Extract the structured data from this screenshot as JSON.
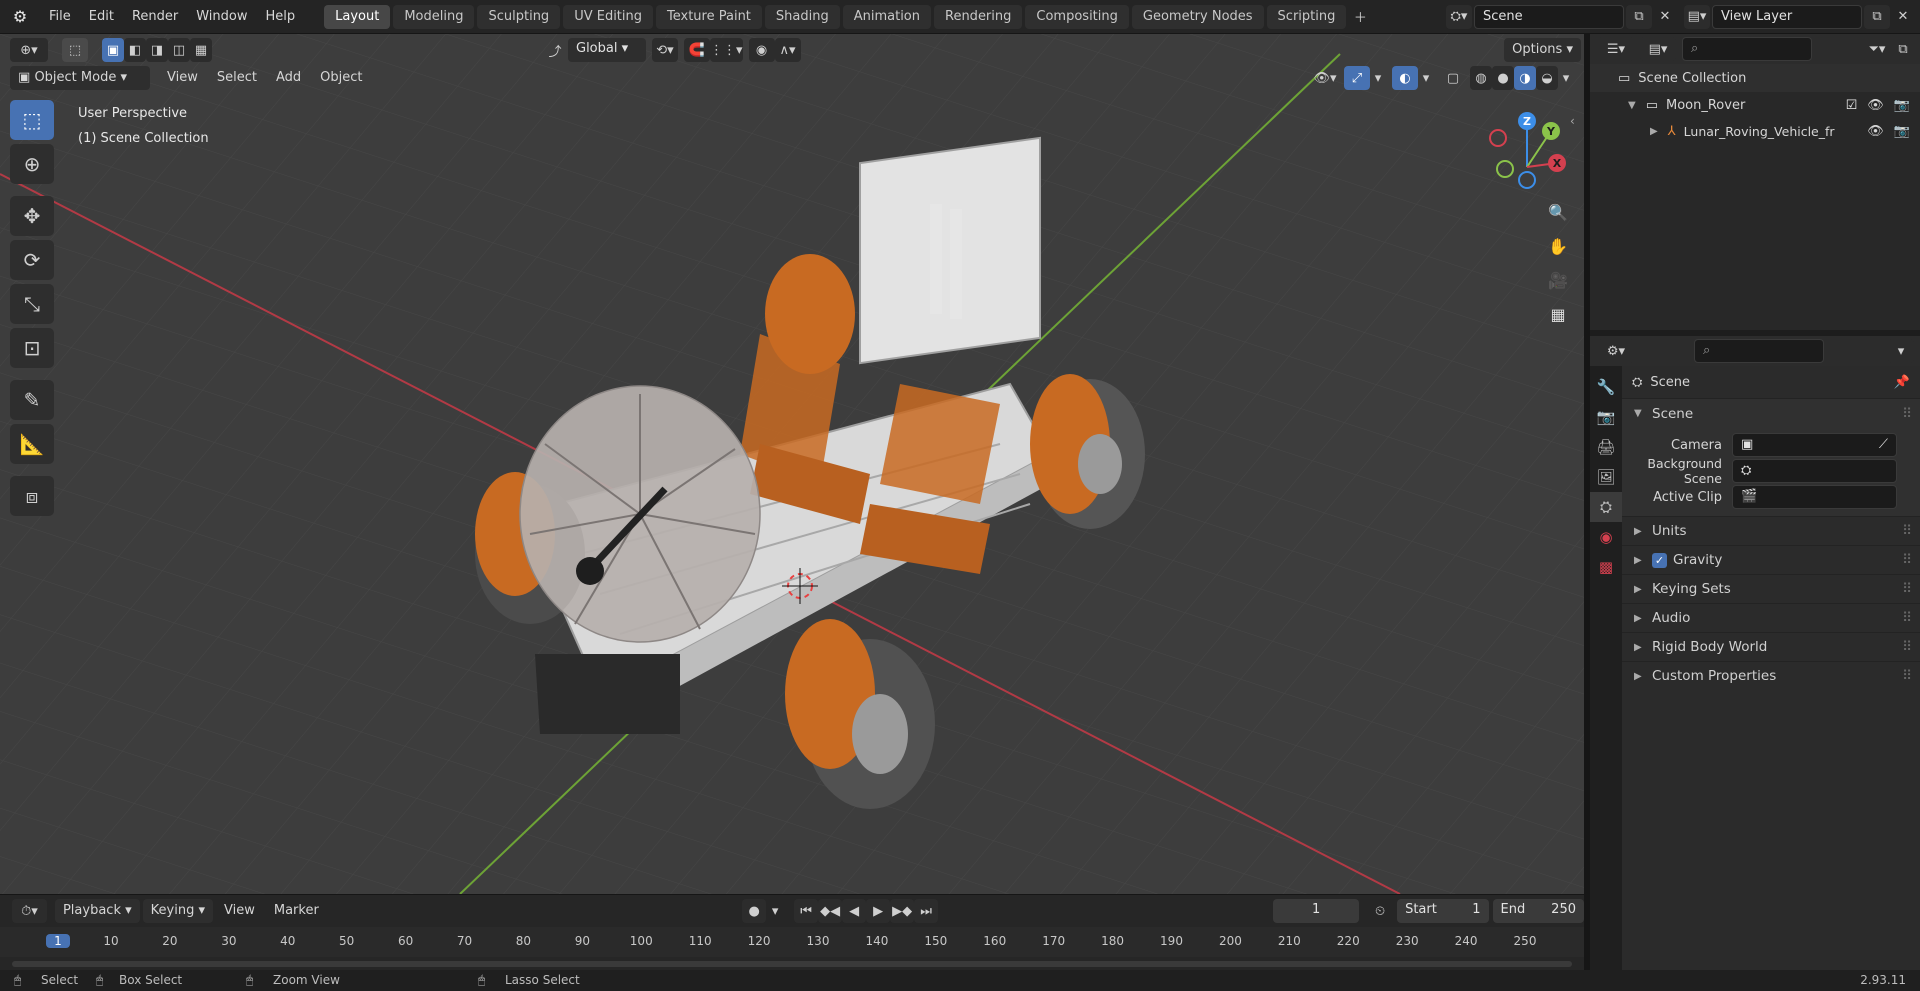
{
  "topbar": {
    "menus": [
      "File",
      "Edit",
      "Render",
      "Window",
      "Help"
    ],
    "workspaces": [
      "Layout",
      "Modeling",
      "Sculpting",
      "UV Editing",
      "Texture Paint",
      "Shading",
      "Animation",
      "Rendering",
      "Compositing",
      "Geometry Nodes",
      "Scripting"
    ],
    "active_workspace": "Layout",
    "scene_name": "Scene",
    "view_layer": "View Layer"
  },
  "viewport": {
    "orientation": "Global",
    "options_label": "Options",
    "mode": "Object Mode",
    "menus": [
      "View",
      "Select",
      "Add",
      "Object"
    ],
    "perspective_label": "User Perspective",
    "collection_label": "(1) Scene Collection",
    "gizmo_axes": [
      "X",
      "Y",
      "Z"
    ]
  },
  "outliner": {
    "root": "Scene Collection",
    "items": [
      {
        "label": "Moon_Rover",
        "level": 1
      },
      {
        "label": "Lunar_Roving_Vehicle_fr",
        "level": 2
      }
    ]
  },
  "properties": {
    "context": "Scene",
    "panel_title": "Scene",
    "fields": [
      {
        "label": "Camera",
        "value": ""
      },
      {
        "label": "Background Scene",
        "value": ""
      },
      {
        "label": "Active Clip",
        "value": ""
      }
    ],
    "subpanels": [
      "Units",
      "Gravity",
      "Keying Sets",
      "Audio",
      "Rigid Body World",
      "Custom Properties"
    ]
  },
  "timeline": {
    "menus": [
      "Playback",
      "Keying",
      "View",
      "Marker"
    ],
    "current_frame": "1",
    "start_label": "Start",
    "start_value": "1",
    "end_label": "End",
    "end_value": "250",
    "ruler": [
      "1",
      "10",
      "20",
      "30",
      "40",
      "50",
      "60",
      "70",
      "80",
      "90",
      "100",
      "110",
      "120",
      "130",
      "140",
      "150",
      "160",
      "170",
      "180",
      "190",
      "200",
      "210",
      "220",
      "230",
      "240",
      "250"
    ]
  },
  "statusbar": {
    "select": "Select",
    "box_select": "Box Select",
    "zoom_view": "Zoom View",
    "lasso_select": "Lasso Select",
    "version": "2.93.11"
  },
  "colors": {
    "accent": "#4772b3",
    "x_axis": "#d4404f",
    "y_axis": "#8bc34a",
    "z_axis": "#3c8ee8",
    "rover_orange": "#c86a22"
  }
}
